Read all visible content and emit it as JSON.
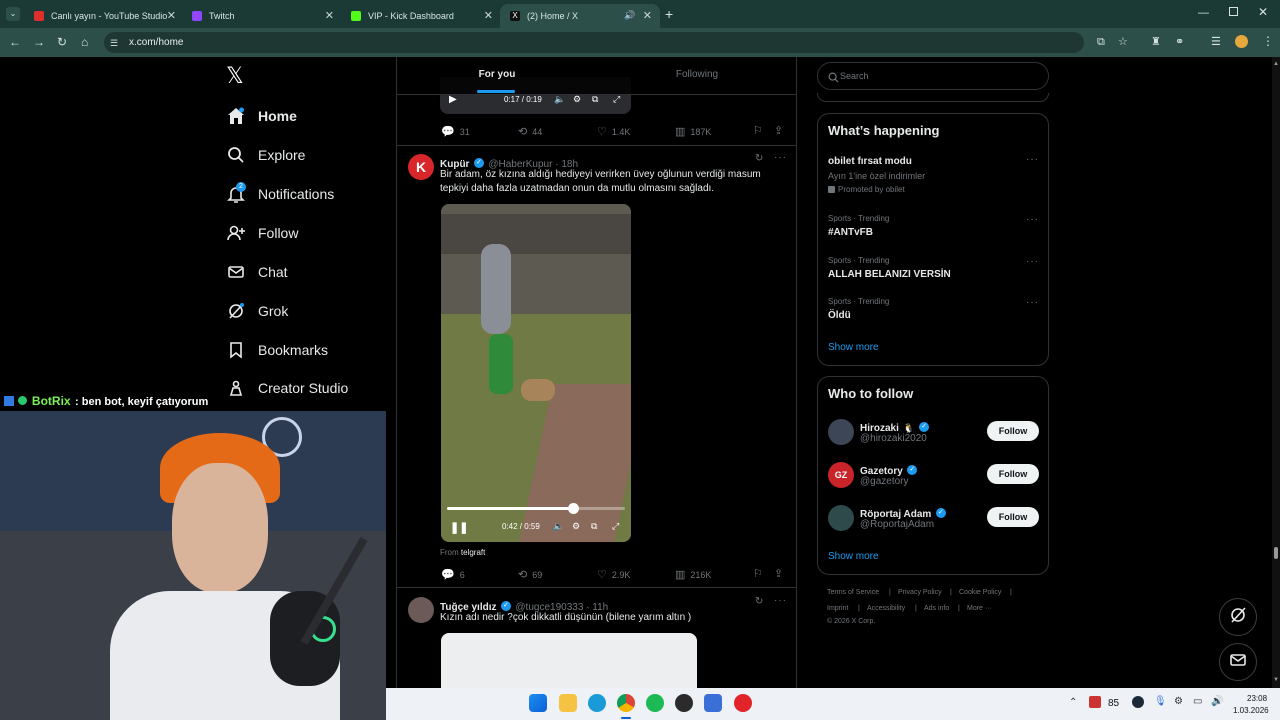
{
  "browser": {
    "tabs": [
      {
        "label": "Canlı yayın - YouTube Studio",
        "color": "#e02d2d"
      },
      {
        "label": "Twitch",
        "color": "#9146ff"
      },
      {
        "label": "VIP - Kick Dashboard",
        "color": "#53fc18"
      },
      {
        "label": "(2) Home / X",
        "color": "#000000"
      }
    ],
    "new_tab": "+",
    "url": "x.com/home"
  },
  "x": {
    "logo": "𝕏",
    "nav": [
      {
        "label": "Home",
        "icon": "home-icon"
      },
      {
        "label": "Explore",
        "icon": "search-icon"
      },
      {
        "label": "Notifications",
        "icon": "bell-icon",
        "badge": "2"
      },
      {
        "label": "Follow",
        "icon": "add-person-icon"
      },
      {
        "label": "Chat",
        "icon": "mail-icon"
      },
      {
        "label": "Grok",
        "icon": "grok-icon"
      },
      {
        "label": "Bookmarks",
        "icon": "bookmark-icon"
      },
      {
        "label": "Creator Studio",
        "icon": "creator-icon"
      }
    ],
    "feed_tabs": {
      "for_you": "For you",
      "following": "Following"
    },
    "prev_tweet": {
      "video_time": "0:17 / 0:19",
      "replies": "31",
      "reposts": "44",
      "likes": "1.4K",
      "views": "187K"
    },
    "tweet1": {
      "avatar_letter": "K",
      "name": "Kupür",
      "handle": "@HaberKupur · 18h",
      "text": "Bir adam, öz kızına aldığı hediyeyi verirken üvey oğlunun verdiği masum tepkiyi daha fazla uzatmadan onun da mutlu olmasını sağladı.",
      "video_time": "0:42 / 0:59",
      "video_progress": 0.71,
      "from_label": "From",
      "from_source": "telgraft",
      "replies": "6",
      "reposts": "69",
      "likes": "2.9K",
      "views": "216K"
    },
    "tweet2": {
      "name": "Tuğçe yıldız",
      "handle": "@tugce190333 · 11h",
      "text": "Kızın adı nedir ?çok dikkatli düşünün (bilene yarım altın )"
    },
    "search_placeholder": "Search",
    "happening": {
      "title": "What’s happening",
      "promo_title": "obilet fırsat modu",
      "promo_sub": "Ayın 1'ine özel indirimler",
      "promo_by": "Promoted by obilet",
      "trends": [
        {
          "cat": "Sports · Trending",
          "name": "#ANTvFB"
        },
        {
          "cat": "Sports · Trending",
          "name": "ALLAH BELANIZI VERSİN"
        },
        {
          "cat": "Sports · Trending",
          "name": "Öldü"
        }
      ],
      "show_more": "Show more"
    },
    "who_to_follow": {
      "title": "Who to follow",
      "accounts": [
        {
          "name": "Hirozaki",
          "emoji": "🐧",
          "handle": "@hirozaki2020",
          "btn": "Follow"
        },
        {
          "name": "Gazetory",
          "emoji": "",
          "handle": "@gazetory",
          "btn": "Follow",
          "avatar_text": "GZ"
        },
        {
          "name": "Röportaj Adam",
          "emoji": "",
          "handle": "@RoportajAdam",
          "btn": "Follow"
        }
      ],
      "show_more": "Show more"
    },
    "footer": {
      "links1": [
        "Terms of Service",
        "Privacy Policy",
        "Cookie Policy"
      ],
      "links2": [
        "Imprint",
        "Accessibility",
        "Ads info",
        "More ···"
      ],
      "copyright": "© 2026 X Corp."
    }
  },
  "chat_overlay": {
    "user": "BotRix",
    "message": ": ben bot, keyif çatıyorum"
  },
  "taskbar": {
    "temp": "85",
    "time": "23:08",
    "date": "1.03.2026"
  }
}
